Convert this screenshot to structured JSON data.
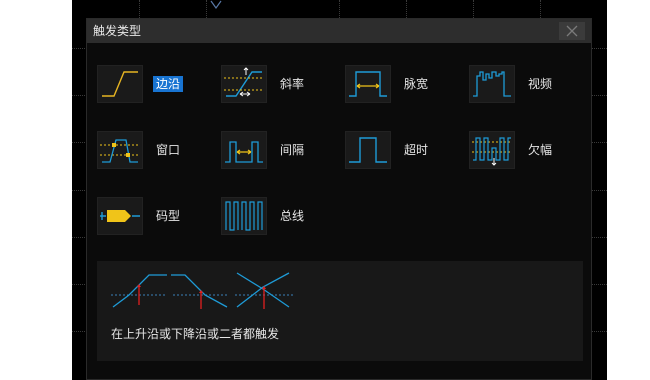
{
  "dialog": {
    "title": "触发类型",
    "close_glyph": "✕"
  },
  "trigger_types": [
    {
      "id": "edge",
      "label": "边沿",
      "icon": "edge-trigger-icon",
      "selected": true
    },
    {
      "id": "slope",
      "label": "斜率",
      "icon": "slope-trigger-icon",
      "selected": false
    },
    {
      "id": "pulse",
      "label": "脉宽",
      "icon": "pulse-width-trigger-icon",
      "selected": false
    },
    {
      "id": "video",
      "label": "视频",
      "icon": "video-trigger-icon",
      "selected": false
    },
    {
      "id": "window",
      "label": "窗口",
      "icon": "window-trigger-icon",
      "selected": false
    },
    {
      "id": "interval",
      "label": "间隔",
      "icon": "interval-trigger-icon",
      "selected": false
    },
    {
      "id": "timeout",
      "label": "超时",
      "icon": "timeout-trigger-icon",
      "selected": false
    },
    {
      "id": "runt",
      "label": "欠幅",
      "icon": "runt-trigger-icon",
      "selected": false
    },
    {
      "id": "pattern",
      "label": "码型",
      "icon": "pattern-trigger-icon",
      "selected": false
    },
    {
      "id": "bus",
      "label": "总线",
      "icon": "bus-trigger-icon",
      "selected": false
    }
  ],
  "description": {
    "icons": [
      "rising-edge-icon",
      "falling-edge-icon",
      "either-edge-icon"
    ],
    "text": "在上升沿或下降沿或二者都触发"
  },
  "colors": {
    "accent": "#1874d2",
    "trace_blue": "#1e9bd7",
    "trigger_yellow": "#f0c419",
    "marker_red": "#e02020",
    "background": "#000000"
  }
}
